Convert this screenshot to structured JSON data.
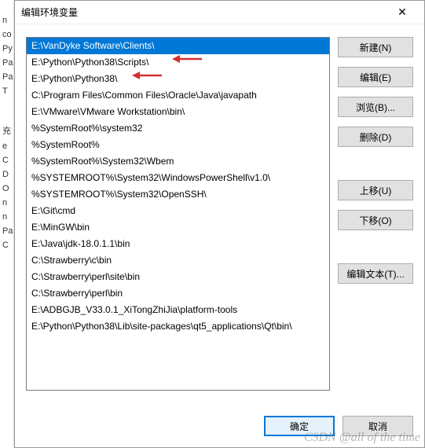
{
  "window": {
    "title": "编辑环境变量",
    "close_icon": "✕"
  },
  "background_labels": [
    "n",
    "co",
    "Py",
    "Pa",
    "Pa",
    "T",
    "",
    "",
    "",
    "",
    "",
    "充",
    "e",
    "C",
    "D",
    "O",
    "n",
    "n",
    "Pa",
    "C"
  ],
  "list": {
    "items": [
      "E:\\VanDyke Software\\Clients\\",
      "E:\\Python\\Python38\\Scripts\\",
      "E:\\Python\\Python38\\",
      "C:\\Program Files\\Common Files\\Oracle\\Java\\javapath",
      "E:\\VMware\\VMware Workstation\\bin\\",
      "%SystemRoot%\\system32",
      "%SystemRoot%",
      "%SystemRoot%\\System32\\Wbem",
      "%SYSTEMROOT%\\System32\\WindowsPowerShell\\v1.0\\",
      "%SYSTEMROOT%\\System32\\OpenSSH\\",
      "E:\\Git\\cmd",
      "E:\\MinGW\\bin",
      "E:\\Java\\jdk-18.0.1.1\\bin",
      "C:\\Strawberry\\c\\bin",
      "C:\\Strawberry\\perl\\site\\bin",
      "C:\\Strawberry\\perl\\bin",
      "E:\\ADBGJB_V33.0.1_XiTongZhiJia\\platform-tools",
      "E:\\Python\\Python38\\Lib\\site-packages\\qt5_applications\\Qt\\bin\\"
    ],
    "selected_index": 0,
    "arrow_indices": [
      1,
      2
    ]
  },
  "buttons": {
    "new": "新建(N)",
    "edit": "编辑(E)",
    "browse": "浏览(B)...",
    "delete": "删除(D)",
    "move_up": "上移(U)",
    "move_down": "下移(O)",
    "edit_text": "编辑文本(T)...",
    "ok": "确定",
    "cancel": "取消"
  },
  "watermark": "CSDN @all of the time"
}
